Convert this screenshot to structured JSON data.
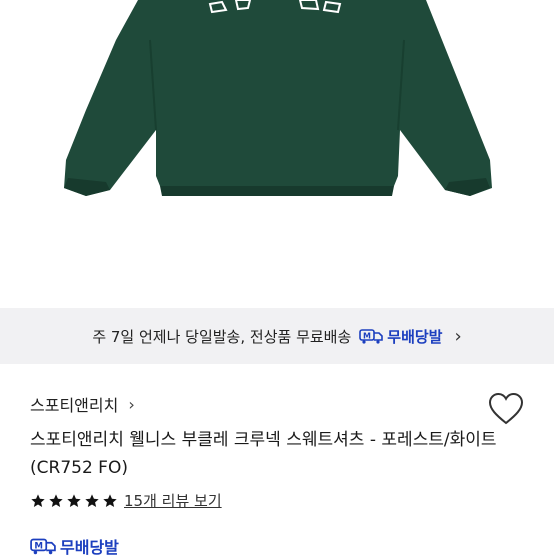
{
  "colors": {
    "sweatshirt": "#1f4a3a",
    "accent_blue": "#1c3fbf",
    "banner_bg": "#f1f1f3"
  },
  "banner": {
    "text": "주 7일 언제나 당일발송, 전상품 무료배송",
    "badge_label": "무배당발",
    "chevron": "›"
  },
  "brand": {
    "name": "스포티앤리치",
    "chevron": "›"
  },
  "product": {
    "title": "스포티앤리치 웰니스 부클레 크루넥 스웨트셔츠 - 포레스트/화이트 (CR752 FO)",
    "rating": 5,
    "review_link": "15개 리뷰 보기"
  },
  "shipping": {
    "badge_label": "무배당발"
  },
  "icons": [
    "m-delivery-icon",
    "heart-icon",
    "star-icon",
    "chevron-right-icon"
  ]
}
